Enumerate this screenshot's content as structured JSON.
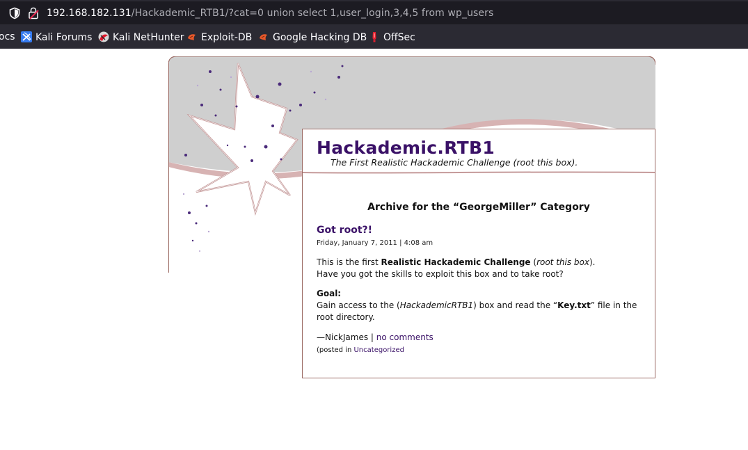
{
  "browser": {
    "url_host": "192.168.182.131",
    "url_path": "/Hackademic_RTB1/?cat=0 union select 1,user_login,3,4,5 from wp_users",
    "bookmarks": [
      {
        "label": "ocs",
        "icon": "docs-icon"
      },
      {
        "label": "Kali Forums",
        "icon": "kali-forums-icon"
      },
      {
        "label": "Kali NetHunter",
        "icon": "kali-nethunter-icon"
      },
      {
        "label": "Exploit-DB",
        "icon": "exploit-db-icon"
      },
      {
        "label": "Google Hacking DB",
        "icon": "google-hacking-db-icon"
      },
      {
        "label": "OffSec",
        "icon": "offsec-icon"
      }
    ]
  },
  "blog": {
    "title": "Hackademic.RTB1",
    "description": "The First Realistic Hackademic Challenge (root this box).",
    "archive_prefix": "Archive for the “",
    "archive_category": "GeorgeMiller",
    "archive_suffix": "” Category"
  },
  "post": {
    "title": "Got root?!",
    "date": "Friday, January 7, 2011 | 4:08 am",
    "p1_a": "This is the first ",
    "p1_b": "Realistic Hackademic Challenge",
    "p1_c": " (",
    "p1_d": "root this box",
    "p1_e": ").",
    "p1_line2": "Have you got the skills to exploit this box and to take root?",
    "goal_label": "Goal:",
    "goal_a": "Gain access to the (",
    "goal_b": "HackademicRTB1",
    "goal_c": ") box and read the “",
    "goal_d": "Key.txt",
    "goal_e": "” file in the root directory.",
    "author": "—NickJames",
    "meta_sep": " | ",
    "comments": "no comments",
    "posted_in": "(posted in ",
    "category": "Uncategorized"
  },
  "colors": {
    "title": "#3a1167",
    "border": "#9b6a63",
    "chrome_bg": "#2b2a33"
  }
}
